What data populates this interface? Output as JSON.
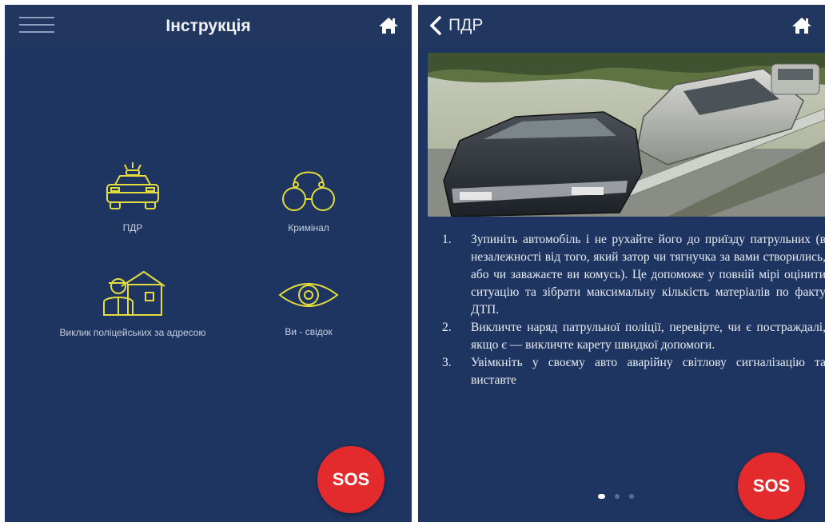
{
  "left_screen": {
    "header": {
      "title": "Інструкція",
      "menu_icon": "hamburger-icon",
      "home_icon": "home-icon"
    },
    "tiles": [
      {
        "label": "ПДР",
        "icon": "police-car-icon"
      },
      {
        "label": "Кримінал",
        "icon": "handcuffs-icon"
      },
      {
        "label": "Виклик поліцейських за адресою",
        "icon": "house-officer-icon"
      },
      {
        "label": "Ви - свідок",
        "icon": "eye-icon"
      }
    ],
    "sos_label": "SOS"
  },
  "right_screen": {
    "header": {
      "back_label": "ПДР",
      "back_icon": "chevron-left-icon",
      "home_icon": "home-icon"
    },
    "photo": {
      "icon": "car-accident-photo"
    },
    "steps": [
      {
        "num": "1.",
        "text": "Зупиніть автомобіль і не рухайте його до приїзду патрульних (в незалежності від того, який затор чи тягнучка за вами створились, або чи заважаєте ви комусь). Це допоможе у повній мірі оцінити ситуацію та зібрати максимальну кількість матеріалів по факту ДТП."
      },
      {
        "num": "2.",
        "text": "Викличте наряд патрульної поліції, перевірте, чи є постраждалі, якщо є — викличте карету швидкої допомоги."
      },
      {
        "num": "3.",
        "text": "Увімкніть у своєму авто аварійну світлову сигналізацію та виставте"
      }
    ],
    "pager": {
      "count": 3,
      "active": 1
    },
    "sos_label": "SOS"
  },
  "colors": {
    "background": "#1e3562",
    "icon_yellow": "#e4dc3c",
    "sos_red": "#e32a2c"
  }
}
